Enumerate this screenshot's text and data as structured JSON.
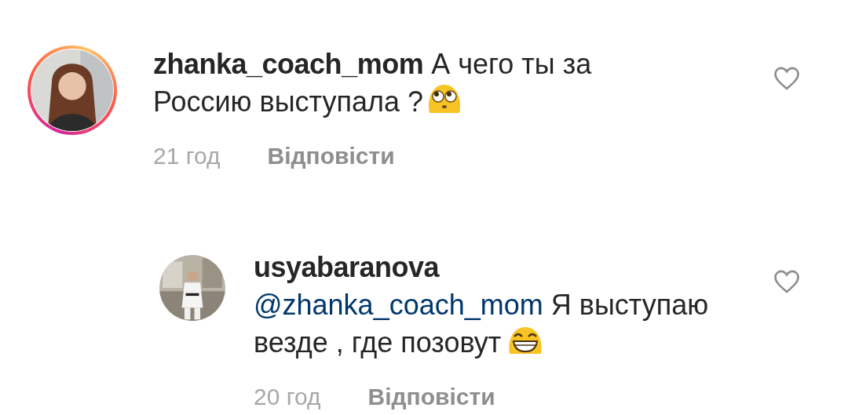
{
  "comments": [
    {
      "username": "zhanka_coach_mom",
      "text": "А чего ты за Россию выступала ?",
      "emoji": {
        "kind": "eyes-up"
      },
      "story_ring": true,
      "reply": false,
      "time": "21 год",
      "reply_label": "Відповісти",
      "liked": false
    },
    {
      "username": "usyabaranova",
      "mention": "@zhanka_coach_mom",
      "text": "Я выступаю везде , где позовут",
      "emoji": {
        "kind": "grin"
      },
      "story_ring": false,
      "reply": true,
      "time": "20 год",
      "reply_label": "Відповісти",
      "liked": false
    }
  ]
}
